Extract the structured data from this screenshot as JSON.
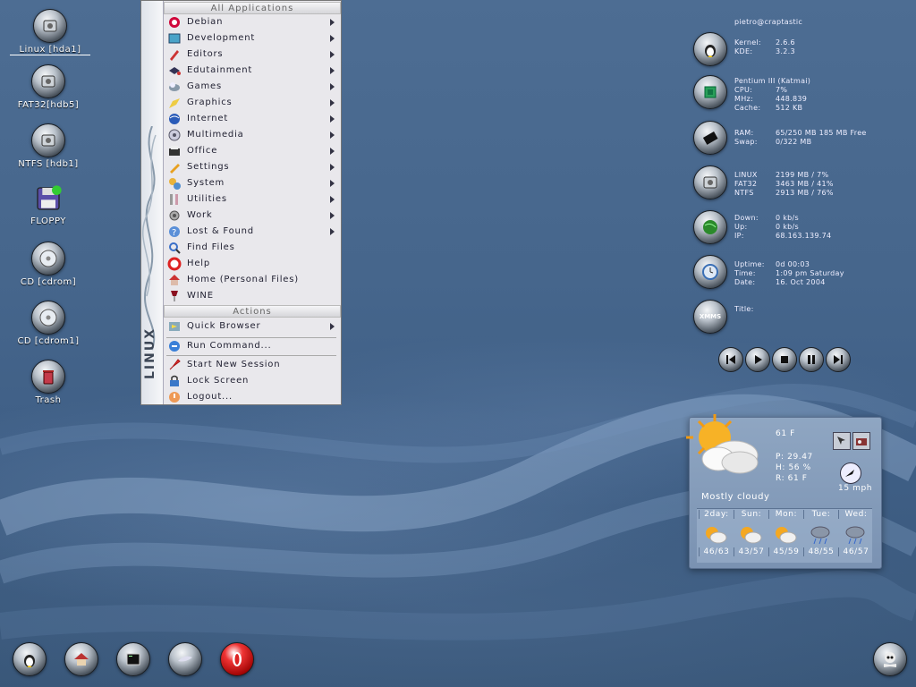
{
  "desktop_icons": [
    {
      "label": "Linux [hda1]",
      "icon": "harddisk-icon"
    },
    {
      "label": "FAT32[hdb5]",
      "icon": "harddisk-icon"
    },
    {
      "label": "NTFS [hdb1]",
      "icon": "harddisk-icon"
    },
    {
      "label": "FLOPPY",
      "icon": "floppy-icon"
    },
    {
      "label": "CD [cdrom]",
      "icon": "cdrom-icon"
    },
    {
      "label": "CD [cdrom1]",
      "icon": "cdrom-icon"
    },
    {
      "label": "Trash",
      "icon": "trash-icon"
    }
  ],
  "menu": {
    "header_all": "All Applications",
    "items": [
      {
        "label": "Debian",
        "icon": "debian-icon",
        "submenu": true
      },
      {
        "label": "Development",
        "icon": "development-icon",
        "submenu": true
      },
      {
        "label": "Editors",
        "icon": "editors-icon",
        "submenu": true
      },
      {
        "label": "Edutainment",
        "icon": "edutainment-icon",
        "submenu": true
      },
      {
        "label": "Games",
        "icon": "games-icon",
        "submenu": true
      },
      {
        "label": "Graphics",
        "icon": "graphics-icon",
        "submenu": true
      },
      {
        "label": "Internet",
        "icon": "internet-icon",
        "submenu": true
      },
      {
        "label": "Multimedia",
        "icon": "multimedia-icon",
        "submenu": true
      },
      {
        "label": "Office",
        "icon": "office-icon",
        "submenu": true
      },
      {
        "label": "Settings",
        "icon": "settings-icon",
        "submenu": true
      },
      {
        "label": "System",
        "icon": "system-icon",
        "submenu": true
      },
      {
        "label": "Utilities",
        "icon": "utilities-icon",
        "submenu": true
      },
      {
        "label": "Work",
        "icon": "work-icon",
        "submenu": true
      },
      {
        "label": "Lost & Found",
        "icon": "lost-found-icon",
        "submenu": true
      },
      {
        "label": "Find Files",
        "icon": "find-icon",
        "submenu": false
      },
      {
        "label": "Help",
        "icon": "help-icon",
        "submenu": false
      },
      {
        "label": "Home (Personal Files)",
        "icon": "home-icon",
        "submenu": false
      },
      {
        "label": "WINE",
        "icon": "wine-icon",
        "submenu": false
      }
    ],
    "header_actions": "Actions",
    "actions": [
      {
        "label": "Quick Browser",
        "icon": "quick-browser-icon",
        "submenu": true
      },
      {
        "label": "Run Command...",
        "icon": "run-command-icon",
        "submenu": false
      },
      {
        "label": "Start New Session",
        "icon": "rocket-icon",
        "submenu": false
      },
      {
        "label": "Lock Screen",
        "icon": "lock-icon",
        "submenu": false
      },
      {
        "label": "Logout...",
        "icon": "logout-icon",
        "submenu": false
      }
    ],
    "sidebar_text": "LINUX"
  },
  "monitor": {
    "host": "pietro@craptastic",
    "system": [
      {
        "label": "Kernel:",
        "value": "2.6.6"
      },
      {
        "label": "KDE:",
        "value": "3.2.3"
      }
    ],
    "cpu_model": "Pentium III (Katmai)",
    "cpu": [
      {
        "label": "CPU:",
        "value": "7%"
      },
      {
        "label": "MHz:",
        "value": "448.839"
      },
      {
        "label": "Cache:",
        "value": "512 KB"
      }
    ],
    "memory": [
      {
        "label": "RAM:",
        "value": "65/250 MB 185 MB Free"
      },
      {
        "label": "Swap:",
        "value": "0/322 MB"
      }
    ],
    "disks": [
      {
        "label": "LINUX",
        "value": "2199 MB / 7%"
      },
      {
        "label": "FAT32",
        "value": "3463 MB / 41%"
      },
      {
        "label": "NTFS",
        "value": "2913 MB / 76%"
      }
    ],
    "network": [
      {
        "label": "Down:",
        "value": "0 kb/s"
      },
      {
        "label": "Up:",
        "value": "0 kb/s"
      },
      {
        "label": "IP:",
        "value": "68.163.139.74"
      }
    ],
    "time": [
      {
        "label": "Uptime:",
        "value": "0d 00:03"
      },
      {
        "label": "Time:",
        "value": "1:09 pm Saturday"
      },
      {
        "label": "Date:",
        "value": "16. Oct 2004"
      }
    ],
    "xmms_label": "XMMS",
    "xmms_title_label": "Title:"
  },
  "weather": {
    "temp": "61 F",
    "pressure": "P: 29.47",
    "humidity": "H: 56 %",
    "realfeel": "R: 61 F",
    "condition": "Mostly cloudy",
    "wind": "15 mph",
    "forecast": [
      {
        "day": "2day:",
        "temps": "46/63",
        "icon": "sun-cloud-icon"
      },
      {
        "day": "Sun:",
        "temps": "43/57",
        "icon": "sun-cloud-icon"
      },
      {
        "day": "Mon:",
        "temps": "45/59",
        "icon": "sun-cloud-icon"
      },
      {
        "day": "Tue:",
        "temps": "48/55",
        "icon": "rain-cloud-icon"
      },
      {
        "day": "Wed:",
        "temps": "46/57",
        "icon": "rain-cloud-icon"
      }
    ]
  }
}
